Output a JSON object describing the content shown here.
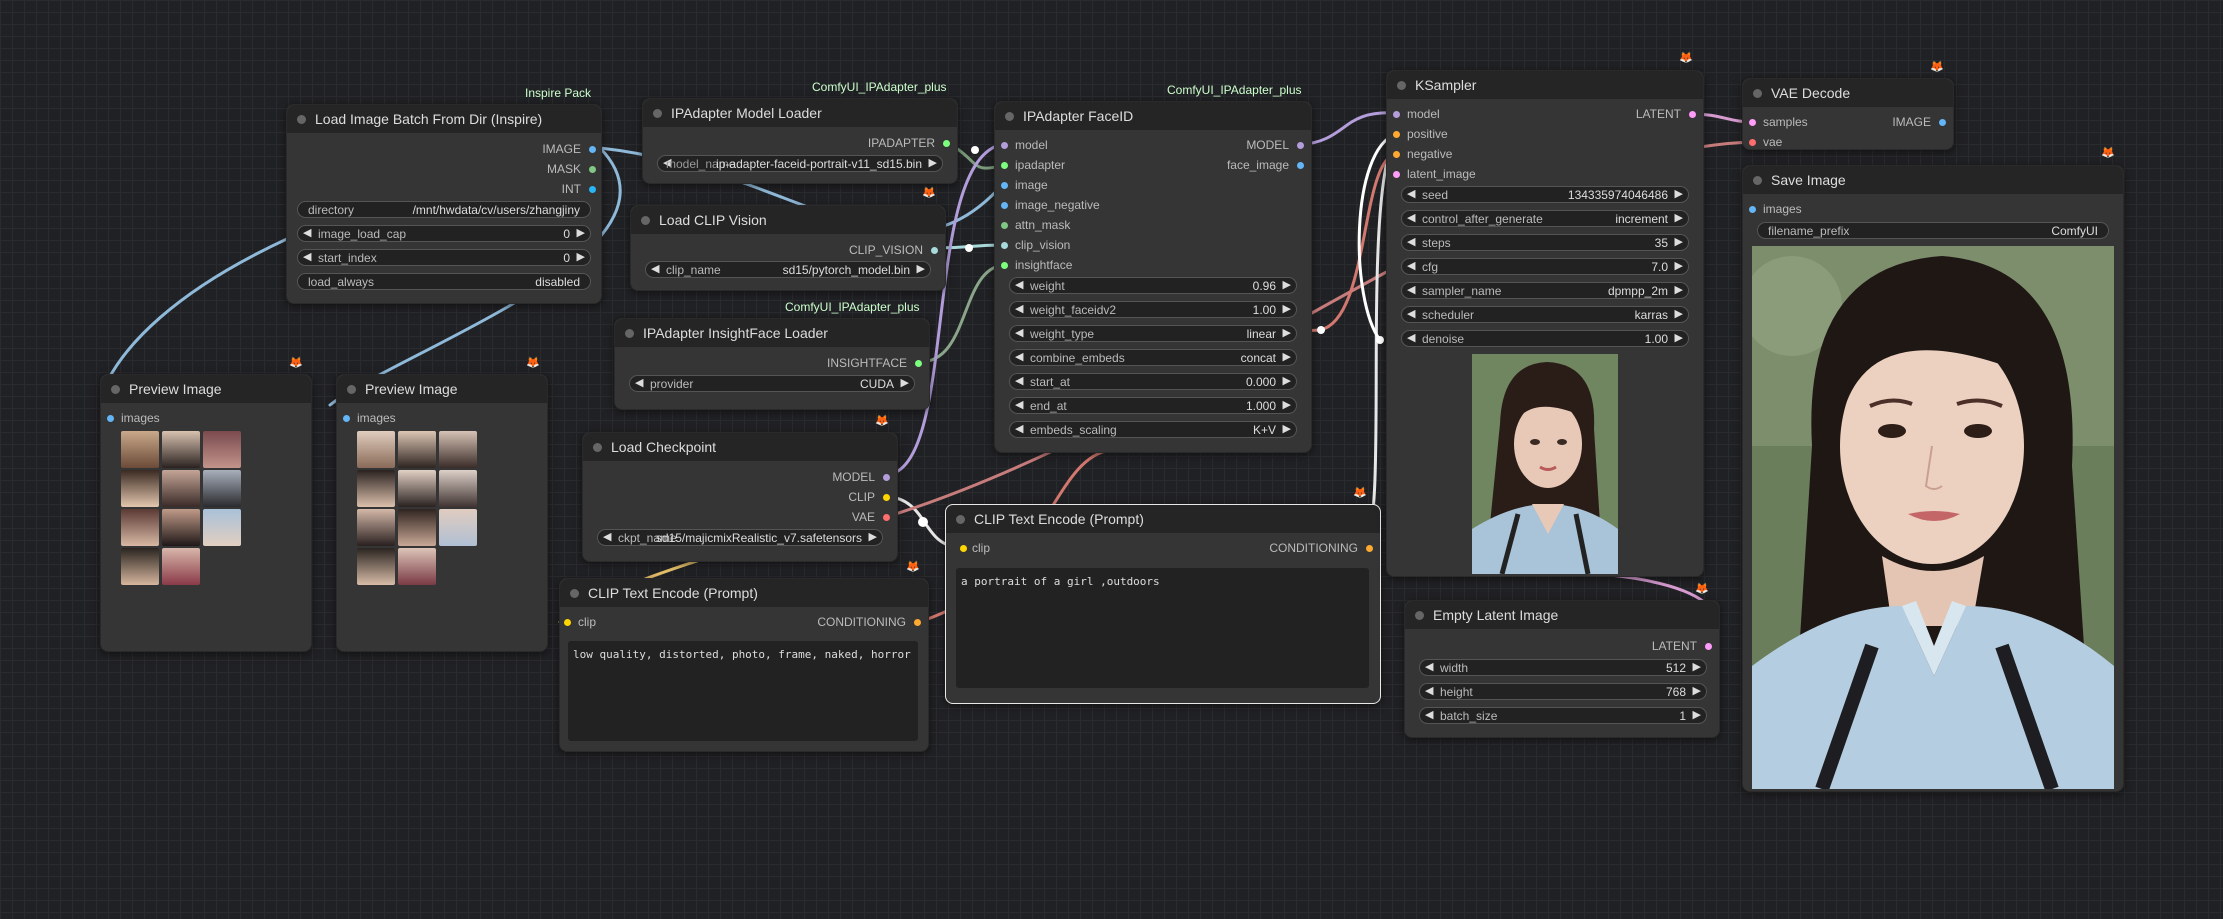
{
  "colors": {
    "model": "#b39ddb",
    "clip": "#ffd500",
    "vae": "#ff6e6e",
    "image": "#64b5f6",
    "latent": "#ff9cf9",
    "conditioning": "#ffa931",
    "ipadapter": "#7cff7c",
    "clip_vision": "#a8dadc",
    "insightface": "#7cff7c",
    "mask": "#81c784",
    "int": "#29b6f6"
  },
  "load_image_batch": {
    "title": "Load Image Batch From Dir (Inspire)",
    "badge": "Inspire Pack",
    "outputs": [
      "IMAGE",
      "MASK",
      "INT"
    ],
    "widgets": [
      {
        "label": "directory",
        "value": "/mnt/hwdata/cv/users/zhangjiny"
      },
      {
        "label": "image_load_cap",
        "value": "0"
      },
      {
        "label": "start_index",
        "value": "0"
      },
      {
        "label": "load_always",
        "value": "disabled"
      }
    ]
  },
  "preview1": {
    "title": "Preview Image",
    "input": "images"
  },
  "preview2": {
    "title": "Preview Image",
    "input": "images"
  },
  "ipa_model_loader": {
    "title": "IPAdapter Model Loader",
    "badge": "ComfyUI_IPAdapter_plus",
    "output": "IPADAPTER",
    "widget_value": "ip-adapter-faceid-portrait-v11_sd15.bin",
    "widget_overlap": "model_name"
  },
  "load_clip_vision": {
    "title": "Load CLIP Vision",
    "output": "CLIP_VISION",
    "widget": {
      "label": "clip_name",
      "value": "sd15/pytorch_model.bin"
    }
  },
  "insightface_loader": {
    "title": "IPAdapter InsightFace Loader",
    "badge": "ComfyUI_IPAdapter_plus",
    "output": "INSIGHTFACE",
    "widget": {
      "label": "provider",
      "value": "CUDA"
    }
  },
  "load_checkpoint": {
    "title": "Load Checkpoint",
    "outputs": [
      "MODEL",
      "CLIP",
      "VAE"
    ],
    "widget": {
      "label": "ckpt_name",
      "value": "sd15/majicmixRealistic_v7.safetensors"
    }
  },
  "clip_neg": {
    "title": "CLIP Text Encode (Prompt)",
    "input": "clip",
    "output": "CONDITIONING",
    "text": "low quality, distorted, photo, frame, naked, horror"
  },
  "faceid": {
    "title": "IPAdapter FaceID",
    "badge": "ComfyUI_IPAdapter_plus",
    "inputs": [
      "model",
      "ipadapter",
      "image",
      "image_negative",
      "attn_mask",
      "clip_vision",
      "insightface"
    ],
    "outputs": [
      "MODEL",
      "face_image"
    ],
    "widgets": [
      {
        "label": "weight",
        "value": "0.96"
      },
      {
        "label": "weight_faceidv2",
        "value": "1.00"
      },
      {
        "label": "weight_type",
        "value": "linear"
      },
      {
        "label": "combine_embeds",
        "value": "concat"
      },
      {
        "label": "start_at",
        "value": "0.000"
      },
      {
        "label": "end_at",
        "value": "1.000"
      },
      {
        "label": "embeds_scaling",
        "value": "K+V"
      }
    ]
  },
  "clip_pos": {
    "title": "CLIP Text Encode (Prompt)",
    "input": "clip",
    "output": "CONDITIONING",
    "text": "a portrait of a girl ,outdoors"
  },
  "ksampler": {
    "title": "KSampler",
    "inputs": [
      "model",
      "positive",
      "negative",
      "latent_image"
    ],
    "output": "LATENT",
    "widgets": [
      {
        "label": "seed",
        "value": "134335974046486"
      },
      {
        "label": "control_after_generate",
        "value": "increment"
      },
      {
        "label": "steps",
        "value": "35"
      },
      {
        "label": "cfg",
        "value": "7.0"
      },
      {
        "label": "sampler_name",
        "value": "dpmpp_2m"
      },
      {
        "label": "scheduler",
        "value": "karras"
      },
      {
        "label": "denoise",
        "value": "1.00"
      }
    ]
  },
  "empty_latent": {
    "title": "Empty Latent Image",
    "output": "LATENT",
    "widgets": [
      {
        "label": "width",
        "value": "512"
      },
      {
        "label": "height",
        "value": "768"
      },
      {
        "label": "batch_size",
        "value": "1"
      }
    ]
  },
  "vae_decode": {
    "title": "VAE Decode",
    "inputs": [
      "samples",
      "vae"
    ],
    "output": "IMAGE"
  },
  "save_image": {
    "title": "Save Image",
    "input": "images",
    "widget": {
      "label": "filename_prefix",
      "value": "ComfyUI"
    }
  }
}
